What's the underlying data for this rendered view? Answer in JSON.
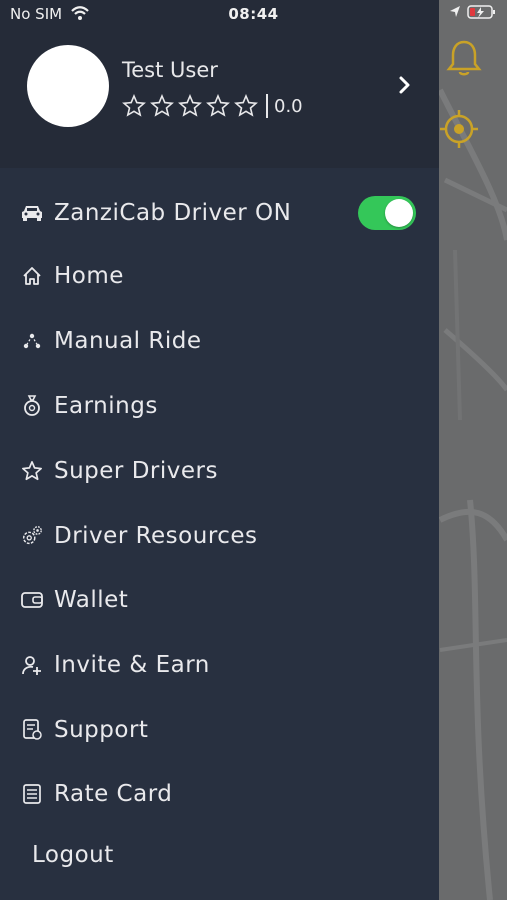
{
  "status_bar": {
    "carrier": "No SIM",
    "time": "08:44"
  },
  "profile": {
    "name": "Test User",
    "rating_value": "0.0",
    "stars_filled": 0,
    "stars_total": 5
  },
  "driver_toggle": {
    "label": "ZanziCab Driver ON",
    "on": true,
    "color": "#34c759"
  },
  "menu": [
    {
      "label": "Home",
      "icon": "home-icon"
    },
    {
      "label": "Manual Ride",
      "icon": "route-icon"
    },
    {
      "label": "Earnings",
      "icon": "money-bag-icon"
    },
    {
      "label": "Super Drivers",
      "icon": "star-icon"
    },
    {
      "label": "Driver Resources",
      "icon": "gear-icon"
    },
    {
      "label": "Wallet",
      "icon": "wallet-icon"
    },
    {
      "label": "Invite & Earn",
      "icon": "add-user-icon"
    },
    {
      "label": "Support",
      "icon": "support-doc-icon"
    },
    {
      "label": "Rate Card",
      "icon": "list-icon"
    }
  ],
  "logout": "Logout",
  "colors": {
    "drawer_bg": "#283040",
    "header_bg": "#252b38",
    "text": "#e9e9ec",
    "bell": "#c9a227"
  }
}
